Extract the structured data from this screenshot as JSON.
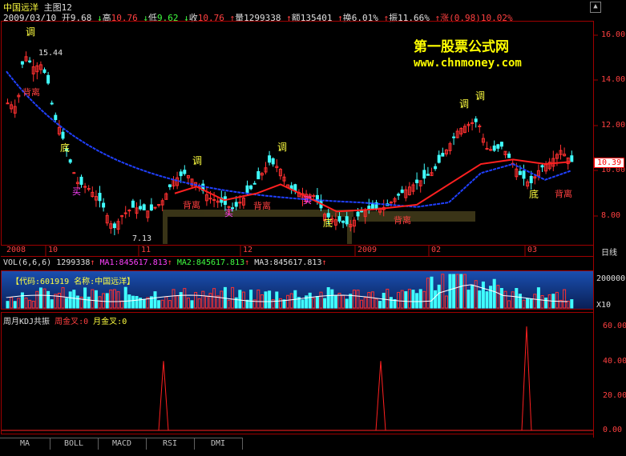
{
  "header": {
    "stock_name": "中国远洋",
    "chart_title": "主图12",
    "date": "2009/03/10",
    "open_label": "开",
    "open": "9.68",
    "high_label": "高",
    "high": "10.76",
    "low_label": "低",
    "low": "9.62",
    "close_label": "收",
    "close": "10.76",
    "vol_label": "量",
    "vol": "1299338",
    "amt_label": "额",
    "amt": "135401",
    "turn_label": "换",
    "turn": "6.01%",
    "amp_label": "振",
    "amp": "11.66%",
    "chg_label": "涨",
    "chg": "(0.98)",
    "chg_pct": "10.02%"
  },
  "watermark": {
    "line1": "第一股票公式网",
    "line2": "www.chnmoney.com"
  },
  "price_axis": [
    "16.00",
    "14.00",
    "12.00",
    "10.00",
    "8.00"
  ],
  "current_price": "10.39",
  "x_axis_labels": [
    "2008",
    "10",
    "11",
    "12",
    "2009",
    "02",
    "03"
  ],
  "period_label": "日线",
  "annotations": {
    "tiao": "调",
    "bei_li": "背离",
    "di": "底",
    "mai": "买",
    "high_mark": "15.44",
    "low_mark": "7.13"
  },
  "volume_panel": {
    "title": "VOL(6,6,6)",
    "vol": "1299338",
    "ma1": "MA1:845617.813",
    "ma2": "MA2:845617.813",
    "ma3": "MA3:845617.813",
    "code_info": "【代码:601919 名称:中国远洋】",
    "axis_label": "200000",
    "scale": "X10"
  },
  "kdj_panel": {
    "title": "周月KDJ共振",
    "week_cross": "周金叉:0",
    "month_cross": "月金叉:0",
    "axis": [
      "60.00",
      "40.00",
      "20.00",
      "0.00"
    ]
  },
  "tabs": [
    "MA",
    "BOLL",
    "MACD",
    "RSI",
    "DMI"
  ],
  "chart_data": {
    "type": "line",
    "title": "周月KDJ共振",
    "x": [],
    "series": [],
    "kdj_spikes": [
      {
        "x_label_near": "11",
        "value": 40
      },
      {
        "x_label_near": "2009",
        "value": 40
      },
      {
        "x_label_near": "03",
        "value": 60
      }
    ],
    "ylim": [
      0,
      65
    ]
  }
}
